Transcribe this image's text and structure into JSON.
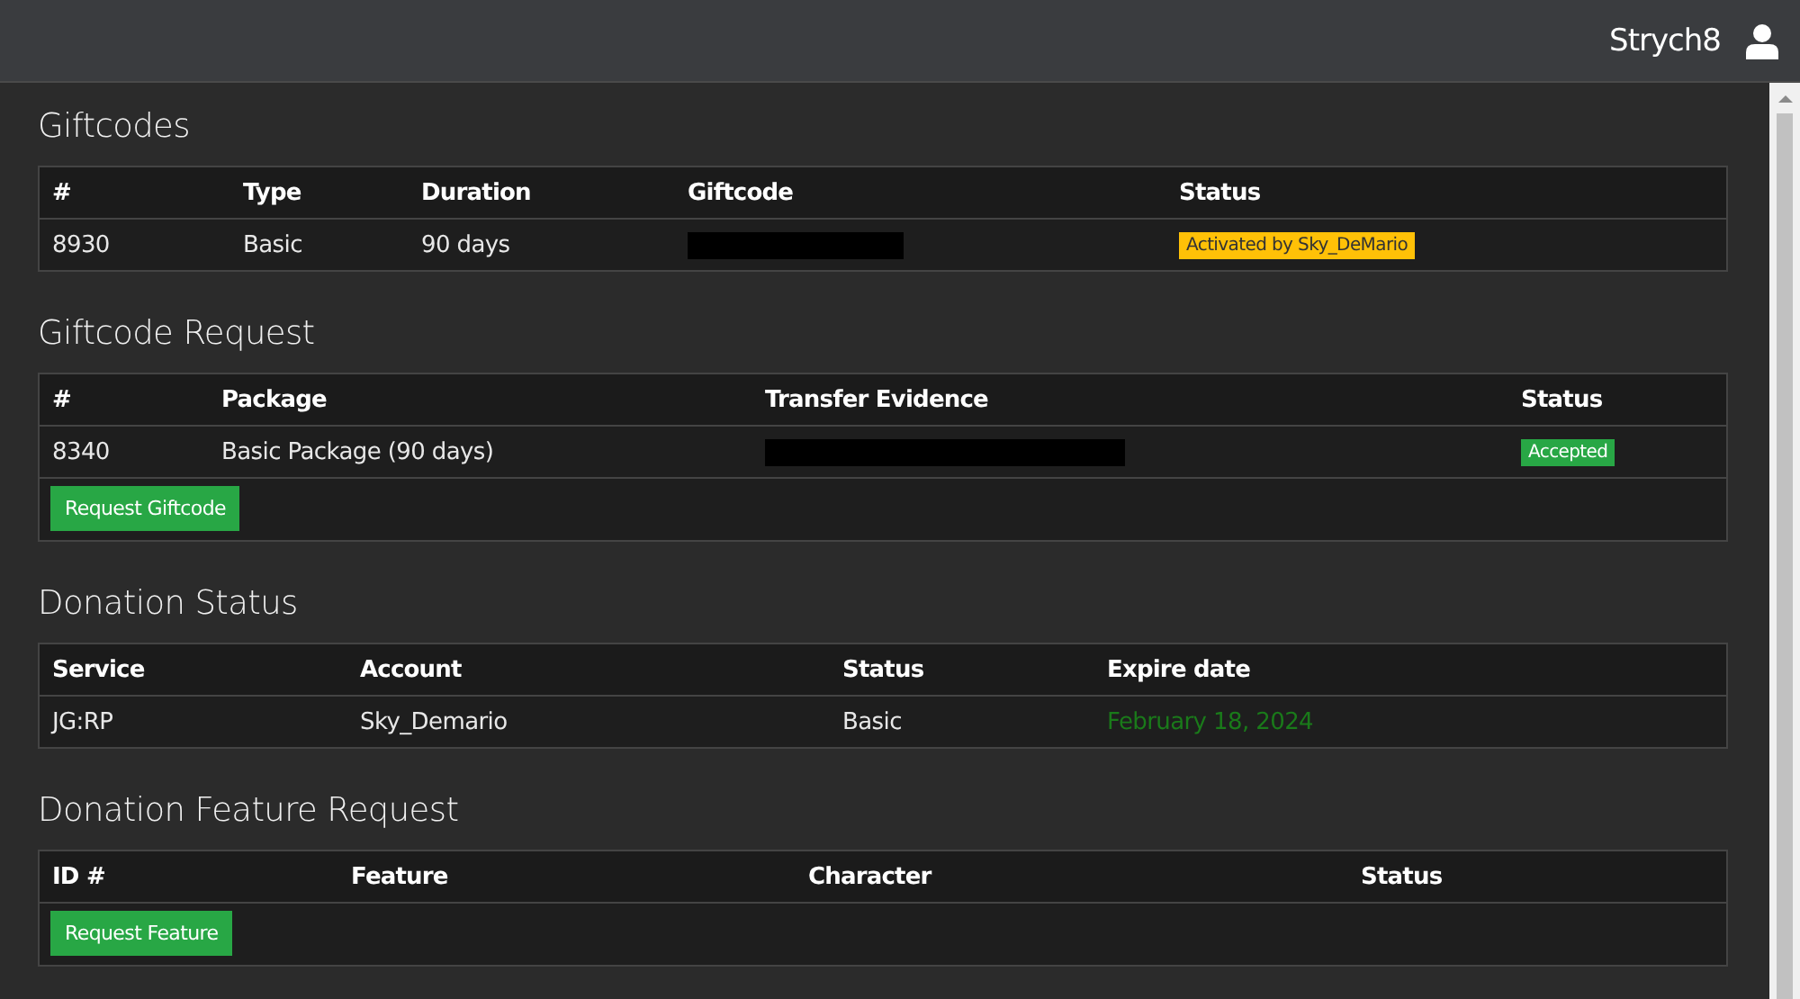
{
  "header": {
    "username": "Strych8"
  },
  "sections": [
    {
      "title": "Giftcodes",
      "columns": [
        "#",
        "Type",
        "Duration",
        "Giftcode",
        "Status"
      ],
      "rows": [
        [
          {
            "kind": "text",
            "text": "8930"
          },
          {
            "kind": "text",
            "text": "Basic"
          },
          {
            "kind": "text",
            "text": "90 days"
          },
          {
            "kind": "redacted"
          },
          {
            "kind": "badge",
            "text": "Activated by Sky_DeMario",
            "color": "#ffc107"
          }
        ]
      ]
    },
    {
      "title": "Giftcode Request",
      "columns": [
        "#",
        "Package",
        "Transfer Evidence",
        "Status"
      ],
      "rows": [
        [
          {
            "kind": "text",
            "text": "8340"
          },
          {
            "kind": "text",
            "text": "Basic Package (90 days)"
          },
          {
            "kind": "redacted"
          },
          {
            "kind": "badge",
            "text": "Accepted",
            "color": "#28a745"
          }
        ]
      ],
      "action": "Request Giftcode"
    },
    {
      "title": "Donation Status",
      "columns": [
        "Service",
        "Account",
        "Status",
        "Expire date"
      ],
      "rows": [
        [
          {
            "kind": "text",
            "text": "JG:RP"
          },
          {
            "kind": "text",
            "text": "Sky_Demario"
          },
          {
            "kind": "text",
            "text": "Basic"
          },
          {
            "kind": "date",
            "text": "February 18, 2024"
          }
        ]
      ]
    },
    {
      "title": "Donation Feature Request",
      "columns": [
        "ID #",
        "Feature",
        "Character",
        "Status"
      ],
      "action": "Request Feature"
    }
  ]
}
